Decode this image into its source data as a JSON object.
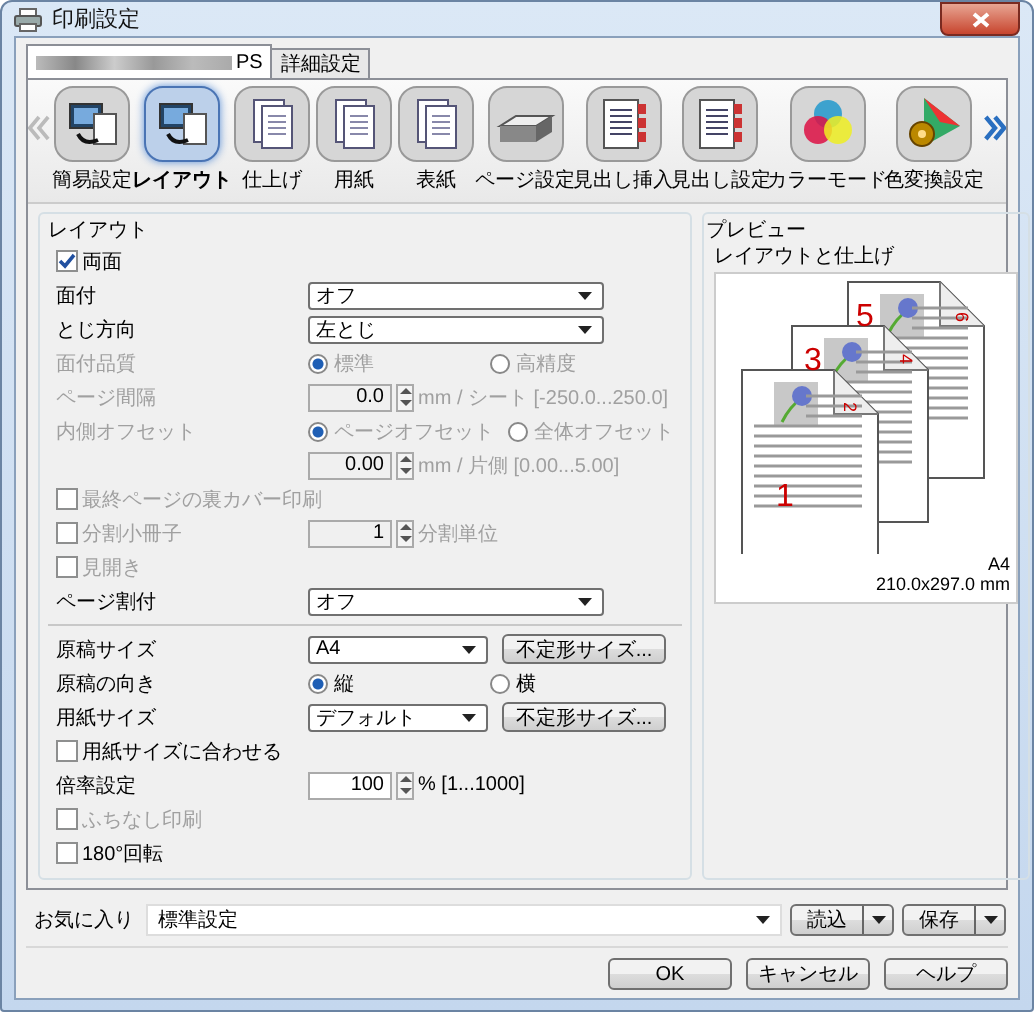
{
  "window": {
    "title": "印刷設定"
  },
  "tabs": [
    {
      "label": "PS",
      "redacted": true,
      "selected": true
    },
    {
      "label": "詳細設定",
      "redacted": false,
      "selected": false
    }
  ],
  "toolbar": [
    {
      "label": "簡易設定",
      "selected": false
    },
    {
      "label": "レイアウト",
      "selected": true
    },
    {
      "label": "仕上げ",
      "selected": false
    },
    {
      "label": "用紙",
      "selected": false
    },
    {
      "label": "表紙",
      "selected": false
    },
    {
      "label": "ページ設定",
      "selected": false
    },
    {
      "label": "見出し挿入",
      "selected": false
    },
    {
      "label": "見出し設定",
      "selected": false
    },
    {
      "label": "カラーモード",
      "selected": false
    },
    {
      "label": "色変換設定",
      "selected": false
    }
  ],
  "layout": {
    "title": "レイアウト",
    "rows": [
      {
        "kind": "checkbox",
        "label": "両面",
        "checked": true,
        "disabled": false
      },
      {
        "kind": "select",
        "label": "面付",
        "value": "オフ",
        "disabled": false
      },
      {
        "kind": "select",
        "label": "とじ方向",
        "value": "左とじ",
        "disabled": false
      },
      {
        "kind": "radio",
        "label": "面付品質",
        "disabled": true,
        "options": [
          {
            "label": "標準",
            "selected": true
          },
          {
            "label": "高精度",
            "selected": false
          }
        ]
      },
      {
        "kind": "spin",
        "label": "ページ間隔",
        "value": "0.0",
        "unit": "mm / シート [-250.0...250.0]",
        "disabled": true
      },
      {
        "kind": "radio",
        "label": "内側オフセット",
        "disabled": true,
        "options": [
          {
            "label": "ページオフセット",
            "selected": true
          },
          {
            "label": "全体オフセット",
            "selected": false
          }
        ]
      },
      {
        "kind": "spin",
        "value": "0.00",
        "unit": "mm / 片側 [0.00...5.00]",
        "disabled": true
      },
      {
        "kind": "checkbox",
        "label": "最終ページの裏カバー印刷",
        "checked": false,
        "disabled": true
      },
      {
        "kind": "checkbox_spin",
        "label": "分割小冊子",
        "checked": false,
        "value": "1",
        "unit": "分割単位",
        "disabled": true
      },
      {
        "kind": "checkbox",
        "label": "見開き",
        "checked": false,
        "disabled": true
      },
      {
        "kind": "select",
        "label": "ページ割付",
        "value": "オフ",
        "disabled": false
      },
      {
        "kind": "separator"
      },
      {
        "kind": "select_button",
        "label": "原稿サイズ",
        "value": "A4",
        "button": "不定形サイズ...",
        "disabled": false
      },
      {
        "kind": "radio",
        "label": "原稿の向き",
        "disabled": false,
        "options": [
          {
            "label": "縦",
            "selected": true
          },
          {
            "label": "横",
            "selected": false
          }
        ]
      },
      {
        "kind": "select_button",
        "label": "用紙サイズ",
        "value": "デフォルト",
        "button": "不定形サイズ...",
        "disabled": false
      },
      {
        "kind": "checkbox",
        "label": "用紙サイズに合わせる",
        "checked": false,
        "disabled": false
      },
      {
        "kind": "spin",
        "label": "倍率設定",
        "value": "100",
        "unit": "% [1...1000]",
        "disabled": false
      },
      {
        "kind": "checkbox",
        "label": "ふちなし印刷",
        "checked": false,
        "disabled": true
      },
      {
        "kind": "checkbox",
        "label": "180°回転",
        "checked": false,
        "disabled": false
      }
    ]
  },
  "preview": {
    "title": "プレビュー",
    "subtitle": "レイアウトと仕上げ",
    "page_numbers": [
      "1",
      "2",
      "3",
      "4",
      "5",
      "6"
    ],
    "paper": "A4",
    "size": "210.0x297.0 mm"
  },
  "favorites": {
    "label": "お気に入り",
    "value": "標準設定",
    "buttons": [
      "読込",
      "保存"
    ]
  },
  "buttons": [
    "OK",
    "キャンセル",
    "ヘルプ"
  ]
}
